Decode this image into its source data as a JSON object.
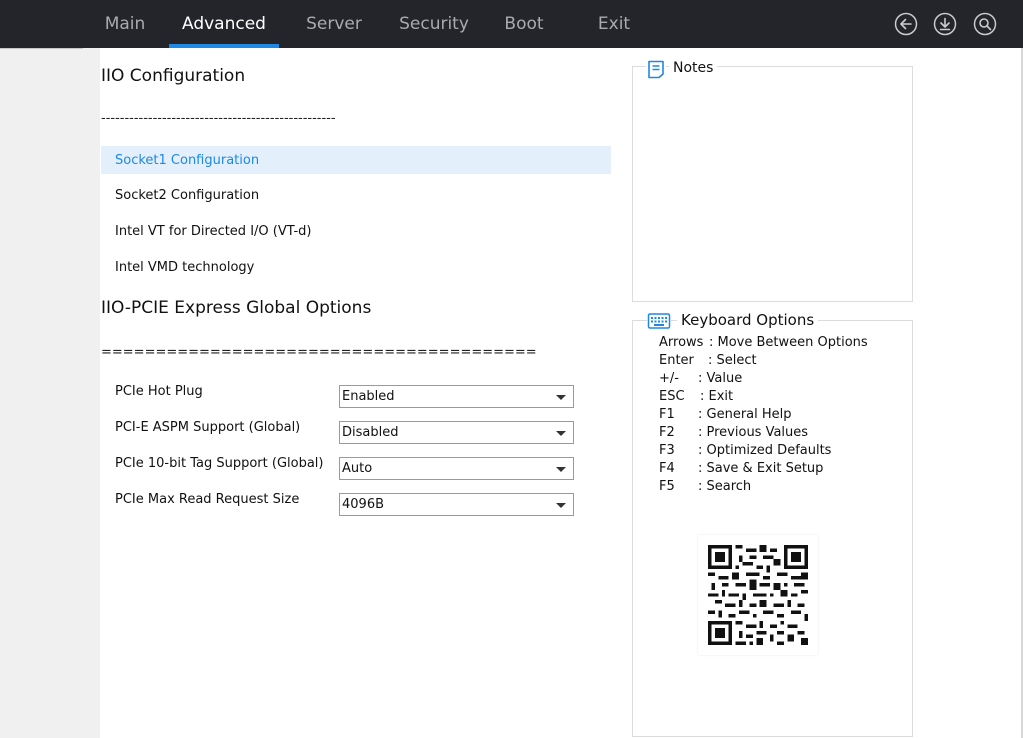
{
  "tabs": [
    {
      "label": "Main",
      "active": false
    },
    {
      "label": "Advanced",
      "active": true
    },
    {
      "label": "Server",
      "active": false
    },
    {
      "label": "Security",
      "active": false
    },
    {
      "label": "Boot",
      "active": false
    },
    {
      "label": "Exit",
      "active": false
    }
  ],
  "icons": {
    "back": "back-arrow-icon",
    "save": "download-icon",
    "search": "search-icon"
  },
  "colors": {
    "accent": "#1e88e5",
    "topbar": "#24252b",
    "selected_bg": "#e3f0fb"
  },
  "main": {
    "title": "IIO Configuration",
    "divider1": "--------------------------------------------------",
    "items": [
      {
        "label": "Socket1 Configuration",
        "selected": true
      },
      {
        "label": "Socket2 Configuration",
        "selected": false
      },
      {
        "label": "Intel VT for Directed I/O (VT-d)",
        "selected": false
      },
      {
        "label": "Intel VMD technology",
        "selected": false
      }
    ],
    "section2_title": "IIO-PCIE Express Global Options",
    "divider2": "========================================",
    "options": [
      {
        "label": "PCIe Hot Plug",
        "value": "Enabled"
      },
      {
        "label": "PCI-E ASPM Support (Global)",
        "value": "Disabled"
      },
      {
        "label": "PCIe 10-bit Tag Support (Global)",
        "value": "Auto"
      },
      {
        "label": "PCIe Max Read Request Size",
        "value": "4096B"
      }
    ]
  },
  "notes": {
    "title": "Notes"
  },
  "keyboard": {
    "title": "Keyboard Options",
    "lines": [
      {
        "key": "Arrows",
        "desc": ": Move Between Options"
      },
      {
        "key": "Enter",
        "desc": ": Select"
      },
      {
        "key": "+/-",
        "desc": ": Value"
      },
      {
        "key": "ESC",
        "desc": ": Exit"
      },
      {
        "key": "F1",
        "desc": ": General Help"
      },
      {
        "key": "F2",
        "desc": ": Previous Values"
      },
      {
        "key": "F3",
        "desc": ": Optimized Defaults"
      },
      {
        "key": "F4",
        "desc": ": Save & Exit Setup"
      },
      {
        "key": "F5",
        "desc": ": Search"
      }
    ]
  }
}
